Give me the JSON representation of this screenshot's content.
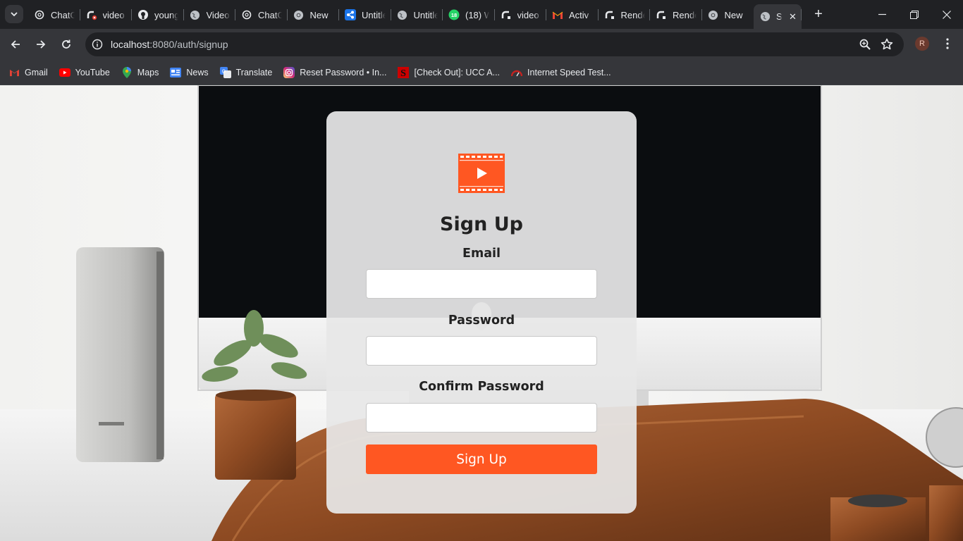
{
  "browser": {
    "tabs": [
      {
        "title": "ChatGPT",
        "icon": "chatgpt-icon"
      },
      {
        "title": "video",
        "icon": "render-icon"
      },
      {
        "title": "young",
        "icon": "github-icon"
      },
      {
        "title": "Video",
        "icon": "globe-icon"
      },
      {
        "title": "ChatGPT",
        "icon": "chatgpt-icon"
      },
      {
        "title": "New",
        "icon": "chrome-icon"
      },
      {
        "title": "Untitled",
        "icon": "share-icon"
      },
      {
        "title": "Untitled",
        "icon": "globe-icon"
      },
      {
        "title": "(18) W",
        "icon": "whatsapp-icon"
      },
      {
        "title": "video",
        "icon": "render-icon"
      },
      {
        "title": "Activ",
        "icon": "gmail-icon"
      },
      {
        "title": "Render",
        "icon": "render-icon"
      },
      {
        "title": "Render",
        "icon": "render-icon"
      },
      {
        "title": "New",
        "icon": "chrome-icon"
      }
    ],
    "active_tab": {
      "title": "S",
      "icon": "globe-icon"
    },
    "url_host": "localhost",
    "url_rest": ":8080/auth/signup",
    "profile_initial": "R",
    "bookmarks": [
      {
        "label": "Gmail",
        "icon": "gmail-icon"
      },
      {
        "label": "YouTube",
        "icon": "youtube-icon"
      },
      {
        "label": "Maps",
        "icon": "maps-icon"
      },
      {
        "label": "News",
        "icon": "news-icon"
      },
      {
        "label": "Translate",
        "icon": "translate-icon"
      },
      {
        "label": "Reset Password • In...",
        "icon": "instagram-icon"
      },
      {
        "label": "[Check Out]: UCC A...",
        "icon": "s-brand-icon"
      },
      {
        "label": "Internet Speed Test...",
        "icon": "speedometer-icon"
      }
    ]
  },
  "signup": {
    "title": "Sign Up",
    "email_label": "Email",
    "email_value": "",
    "password_label": "Password",
    "password_value": "",
    "confirm_label": "Confirm Password",
    "confirm_value": "",
    "submit_label": "Sign Up",
    "logo_icon": "film-play-icon"
  },
  "colors": {
    "accent": "#ff5722",
    "browser_dark": "#202124",
    "browser_toolbar": "#35363a"
  }
}
